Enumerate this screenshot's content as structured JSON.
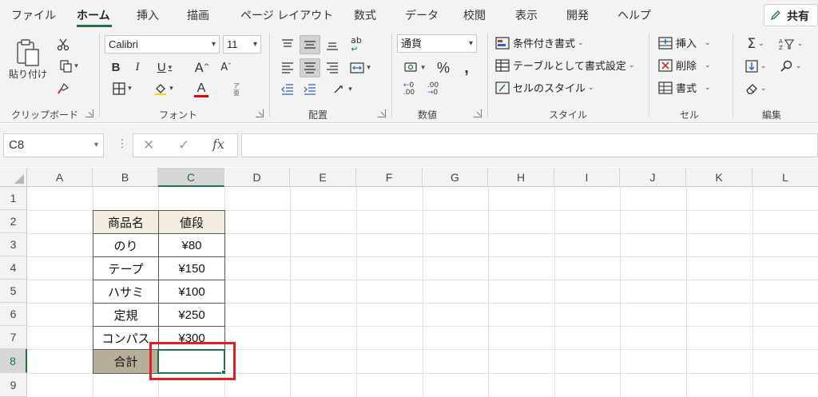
{
  "tabs": [
    {
      "label": "ファイル"
    },
    {
      "label": "ホーム"
    },
    {
      "label": "挿入"
    },
    {
      "label": "描画"
    },
    {
      "label": "ページ レイアウト"
    },
    {
      "label": "数式"
    },
    {
      "label": "データ"
    },
    {
      "label": "校閲"
    },
    {
      "label": "表示"
    },
    {
      "label": "開発"
    },
    {
      "label": "ヘルプ"
    }
  ],
  "share_label": "共有",
  "ribbon": {
    "clipboard": {
      "paste_label": "貼り付け",
      "group_label": "クリップボード"
    },
    "font": {
      "font_name": "Calibri",
      "font_size": "11",
      "group_label": "フォント",
      "font_color": "#e00000"
    },
    "alignment": {
      "group_label": "配置"
    },
    "number": {
      "format": "通貨",
      "group_label": "数値"
    },
    "styles": {
      "conditional_label": "条件付き書式",
      "table_label": "テーブルとして書式設定",
      "cell_styles_label": "セルのスタイル",
      "group_label": "スタイル"
    },
    "cells": {
      "insert_label": "挿入",
      "delete_label": "削除",
      "format_label": "書式",
      "group_label": "セル"
    },
    "editing": {
      "group_label": "編集"
    }
  },
  "formula_bar": {
    "name_box": "C8",
    "formula": ""
  },
  "columns": [
    "A",
    "B",
    "C",
    "D",
    "E",
    "F",
    "G",
    "H",
    "I",
    "J",
    "K",
    "L"
  ],
  "rows": [
    "1",
    "2",
    "3",
    "4",
    "5",
    "6",
    "7",
    "8",
    "9"
  ],
  "table": {
    "header": {
      "name": "商品名",
      "price": "値段"
    },
    "items": [
      {
        "name": "のり",
        "price": "¥80"
      },
      {
        "name": "テープ",
        "price": "¥150"
      },
      {
        "name": "ハサミ",
        "price": "¥100"
      },
      {
        "name": "定規",
        "price": "¥250"
      },
      {
        "name": "コンパス",
        "price": "¥300"
      }
    ],
    "total_label": "合計",
    "total_value": ""
  },
  "colors": {
    "accent": "#217346",
    "highlight_box": "#e02020",
    "header_fill": "#f2eddf",
    "total_fill": "#b6ae99"
  }
}
